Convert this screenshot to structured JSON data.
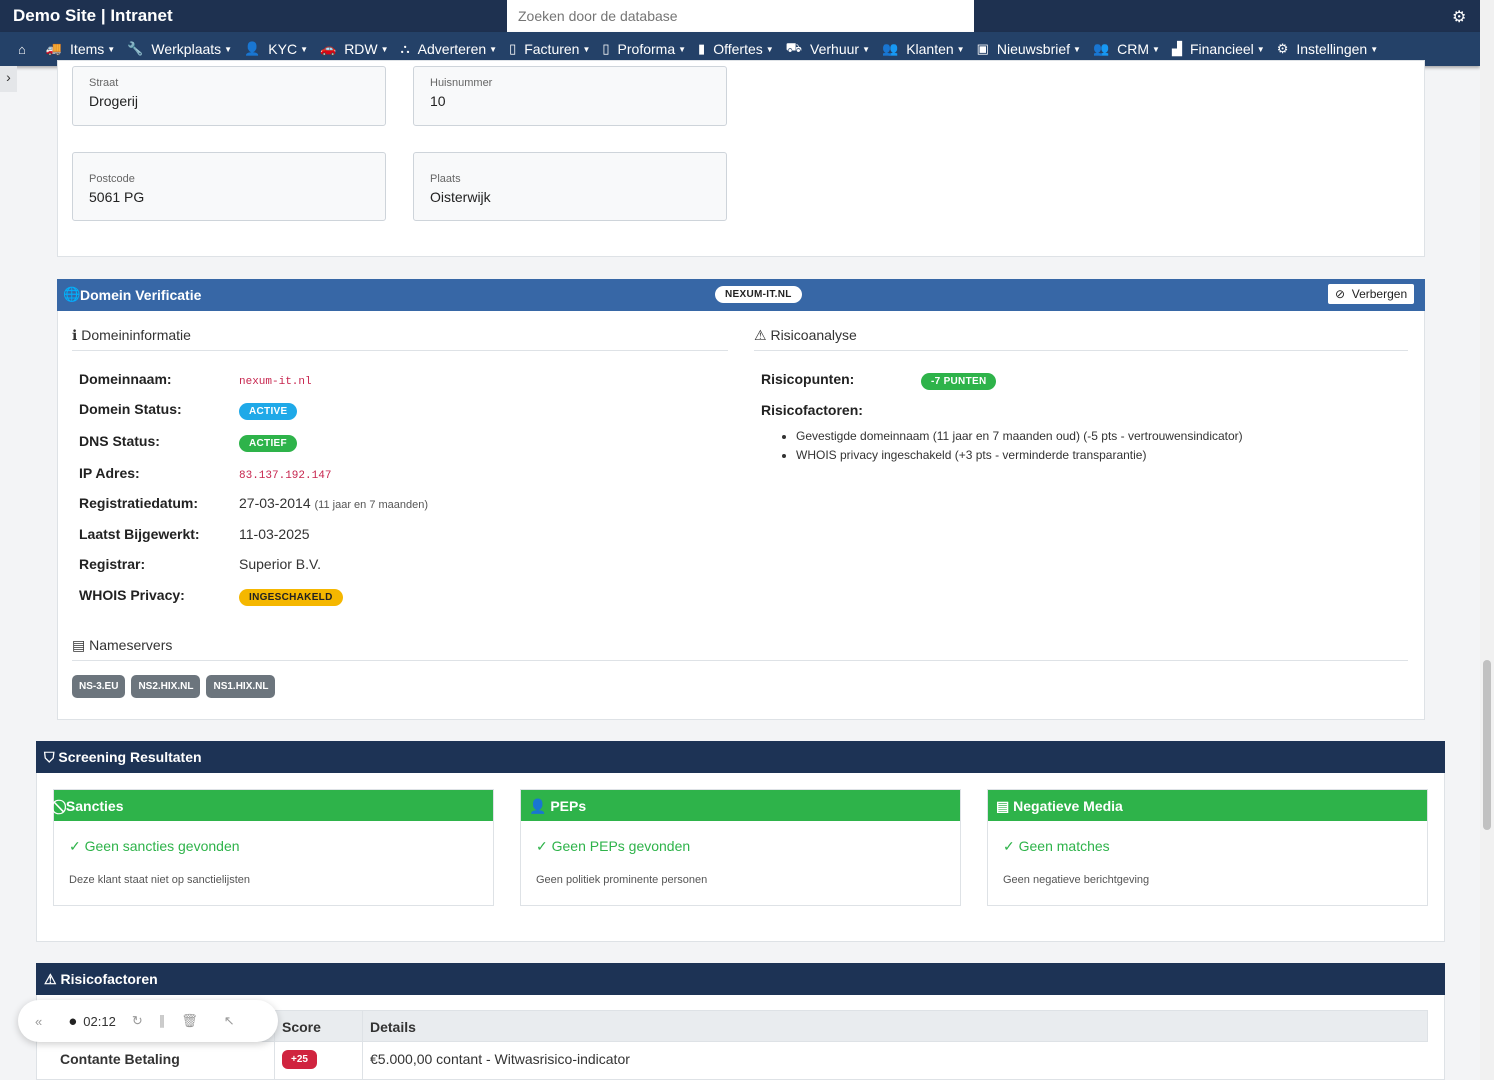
{
  "header": {
    "brand": "Demo Site | Intranet",
    "search_placeholder": "Zoeken door de database"
  },
  "nav": [
    {
      "label": "",
      "icon": "⌂"
    },
    {
      "label": "Items",
      "icon": "🚚"
    },
    {
      "label": "Werkplaats",
      "icon": "🔧"
    },
    {
      "label": "KYC",
      "icon": "👤"
    },
    {
      "label": "RDW",
      "icon": "🚗"
    },
    {
      "label": "Adverteren",
      "icon": "⛬"
    },
    {
      "label": "Facturen",
      "icon": "▯"
    },
    {
      "label": "Proforma",
      "icon": "▯"
    },
    {
      "label": "Offertes",
      "icon": "▮"
    },
    {
      "label": "Verhuur",
      "icon": "⛟"
    },
    {
      "label": "Klanten",
      "icon": "👥"
    },
    {
      "label": "Nieuwsbrief",
      "icon": "▣"
    },
    {
      "label": "CRM",
      "icon": "👥"
    },
    {
      "label": "Financieel",
      "icon": "▟"
    },
    {
      "label": "Instellingen",
      "icon": "⚙"
    }
  ],
  "address": {
    "straat_label": "Straat",
    "straat": "Drogerij",
    "huisnummer_label": "Huisnummer",
    "huisnummer": "10",
    "postcode_label": "Postcode",
    "postcode": "5061 PG",
    "plaats_label": "Plaats",
    "plaats": "Oisterwijk"
  },
  "domain": {
    "title": "Domein Verificatie",
    "domain_badge": "NEXUM-IT.NL",
    "hide_button": "Verbergen",
    "info_title": "Domeininformatie",
    "risk_title": "Risicoanalyse",
    "rows": [
      {
        "label": "Domeinnaam:",
        "value": "nexum-it.nl",
        "type": "code"
      },
      {
        "label": "Domein Status:",
        "value": "ACTIVE",
        "type": "badge",
        "color": "#1fa9e8"
      },
      {
        "label": "DNS Status:",
        "value": "ACTIEF",
        "type": "badge",
        "color": "#2eb34a"
      },
      {
        "label": "IP Adres:",
        "value": "83.137.192.147",
        "type": "code"
      },
      {
        "label": "Registratiedatum:",
        "value": "27-03-2014",
        "note": "(11 jaar en 7 maanden)"
      },
      {
        "label": "Laatst Bijgewerkt:",
        "value": "11-03-2025"
      },
      {
        "label": "Registrar:",
        "value": "Superior B.V."
      },
      {
        "label": "WHOIS Privacy:",
        "value": "INGESCHAKELD",
        "type": "badge",
        "color": "#f5b700"
      }
    ],
    "risk_points_label": "Risicopunten:",
    "risk_points": "-7 PUNTEN",
    "risk_factors_label": "Risicofactoren:",
    "risk_factors": [
      "Gevestigde domeinnaam (11 jaar en 7 maanden oud) (-5 pts - vertrouwensindicator)",
      "WHOIS privacy ingeschakeld (+3 pts - verminderde transparantie)"
    ],
    "nameservers_title": "Nameservers",
    "nameservers": [
      "NS-3.EU",
      "NS2.HIX.NL",
      "NS1.HIX.NL"
    ]
  },
  "screening": {
    "title": "Screening Resultaten",
    "cards": [
      {
        "title": "Sancties",
        "ok": "Geen sancties gevonden",
        "desc": "Deze klant staat niet op sanctielijsten",
        "icon": "⃠"
      },
      {
        "title": "PEPs",
        "ok": "Geen PEPs gevonden",
        "desc": "Geen politiek prominente personen",
        "icon": "👤"
      },
      {
        "title": "Negatieve Media",
        "ok": "Geen matches",
        "desc": "Geen negatieve berichtgeving",
        "icon": "▤"
      }
    ]
  },
  "risk": {
    "title": "Risicofactoren",
    "headers": [
      "Score",
      "Details"
    ],
    "rows": [
      {
        "name": "Contante Betaling",
        "score": "+25",
        "details": "€5.000,00 contant - Witwasrisico-indicator"
      }
    ]
  },
  "recorder": {
    "time": "02:12"
  },
  "colors": {
    "navbar": "#1e3150",
    "nav": "#244168",
    "domain_header": "#3767a6",
    "success": "#2eb34a",
    "danger": "#d0243f"
  }
}
